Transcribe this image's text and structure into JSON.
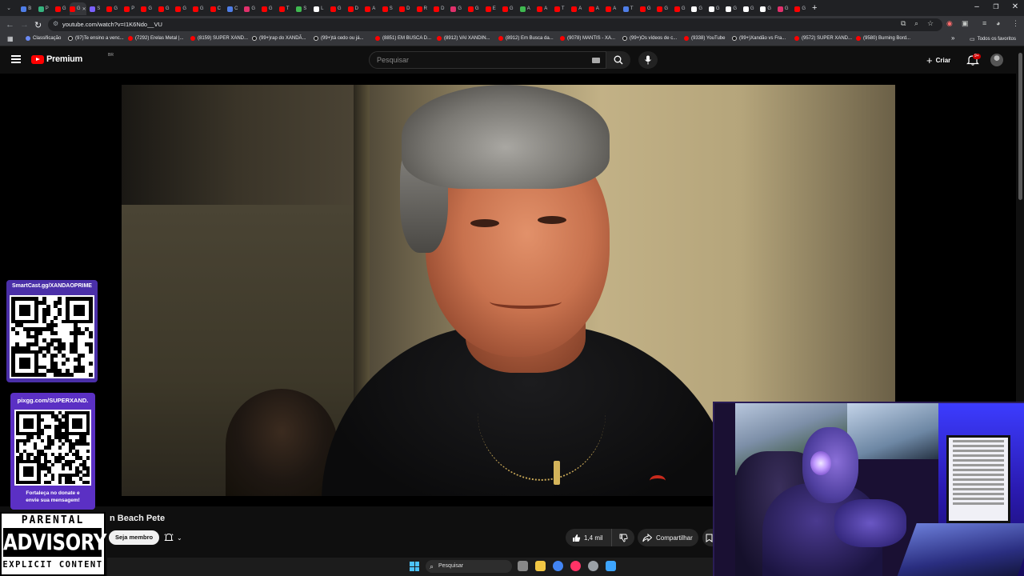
{
  "browser": {
    "tabs": [
      {
        "letter": "B",
        "color": "#4f7ee8"
      },
      {
        "letter": "P",
        "color": "#36b37e"
      },
      {
        "letter": "G",
        "color": "#ff0000"
      },
      {
        "letter": "G",
        "color": "#ff0000",
        "active": true
      },
      {
        "letter": "S",
        "color": "#7b61ff"
      },
      {
        "letter": "G",
        "color": "#ff0000"
      },
      {
        "letter": "P",
        "color": "#ff0000"
      },
      {
        "letter": "G",
        "color": "#ff0000"
      },
      {
        "letter": "G",
        "color": "#ff0000"
      },
      {
        "letter": "G",
        "color": "#ff0000"
      },
      {
        "letter": "G",
        "color": "#ff0000"
      },
      {
        "letter": "C",
        "color": "#ff0000"
      },
      {
        "letter": "C",
        "color": "#4f7ee8"
      },
      {
        "letter": "G",
        "color": "#e1306c"
      },
      {
        "letter": "G",
        "color": "#ff0000"
      },
      {
        "letter": "T",
        "color": "#ff0000"
      },
      {
        "letter": "S",
        "color": "#3fb950"
      },
      {
        "letter": "L",
        "color": "#ffffff"
      },
      {
        "letter": "G",
        "color": "#ff0000"
      },
      {
        "letter": "D",
        "color": "#ff0000"
      },
      {
        "letter": "A",
        "color": "#ff0000"
      },
      {
        "letter": "S",
        "color": "#ff0000"
      },
      {
        "letter": "D",
        "color": "#ff0000"
      },
      {
        "letter": "R",
        "color": "#ff0000"
      },
      {
        "letter": "D",
        "color": "#ff0000"
      },
      {
        "letter": "G",
        "color": "#e1306c"
      },
      {
        "letter": "G",
        "color": "#ff0000"
      },
      {
        "letter": "E",
        "color": "#ff0000"
      },
      {
        "letter": "G",
        "color": "#ff0000"
      },
      {
        "letter": "A",
        "color": "#3fb950"
      },
      {
        "letter": "A",
        "color": "#ff0000"
      },
      {
        "letter": "T",
        "color": "#ff0000"
      },
      {
        "letter": "A",
        "color": "#ff0000"
      },
      {
        "letter": "A",
        "color": "#ff0000"
      },
      {
        "letter": "A",
        "color": "#ff0000"
      },
      {
        "letter": "T",
        "color": "#4f7ee8"
      },
      {
        "letter": "G",
        "color": "#ff0000"
      },
      {
        "letter": "G",
        "color": "#ff0000"
      },
      {
        "letter": "G",
        "color": "#ff0000"
      },
      {
        "letter": "G",
        "color": "#ffffff"
      },
      {
        "letter": "G",
        "color": "#ffffff"
      },
      {
        "letter": "G",
        "color": "#ffffff"
      },
      {
        "letter": "G",
        "color": "#ffffff"
      },
      {
        "letter": "G",
        "color": "#ffffff"
      },
      {
        "letter": "G",
        "color": "#e1306c"
      },
      {
        "letter": "G",
        "color": "#ff0000"
      }
    ],
    "url": "youtube.com/watch?v=I1K6Ndo__VU",
    "bookmarks": [
      {
        "label": "Classificação",
        "kind": "cl"
      },
      {
        "label": "(97)Te ensino a venc...",
        "kind": "tk"
      },
      {
        "label": "(7292) Erelas Metal |...",
        "kind": "yt"
      },
      {
        "label": "(8159) SUPER XAND...",
        "kind": "yt"
      },
      {
        "label": "(99+)rap do XANDÃ...",
        "kind": "tk"
      },
      {
        "label": "(99+)tá cedo ou já...",
        "kind": "tk"
      },
      {
        "label": "(8851) EM BUSCA D...",
        "kind": "yt"
      },
      {
        "label": "(8912) VAI XANDIN...",
        "kind": "yt"
      },
      {
        "label": "(8912) Em Busca da...",
        "kind": "yt"
      },
      {
        "label": "(9078) MANTIS - XA...",
        "kind": "yt"
      },
      {
        "label": "(99+)Os vídeos de c...",
        "kind": "tk"
      },
      {
        "label": "(9338) YouTube",
        "kind": "yt"
      },
      {
        "label": "(99+)Xandão vs Fra...",
        "kind": "tk"
      },
      {
        "label": "(9572) SUPER XAND...",
        "kind": "yt"
      },
      {
        "label": "(9580) Burning Bord...",
        "kind": "yt"
      }
    ],
    "all_bookmarks_label": "Todos os favoritos"
  },
  "youtube": {
    "logo_text": "Premium",
    "country_code": "BR",
    "search_placeholder": "Pesquisar",
    "create_label": "Criar",
    "notification_badge": "9+",
    "video_title": "n Beach Pete",
    "join_label": "Seja membro",
    "like_count": "1,4 mil",
    "share_label": "Compartilhar"
  },
  "overlays": {
    "qr1_title": "SmartCast.gg/XANDAOPRIME",
    "qr2_title": "pixgg.com/SUPERXAND.",
    "qr2_message_line1": "Fortaleça no donate e",
    "qr2_message_line2": "envie sua mensagem!",
    "advisory_top": "PARENTAL",
    "advisory_middle": "ADVISORY",
    "advisory_bottom": "EXPLICIT CONTENT"
  },
  "taskbar": {
    "search_placeholder": "Pesquisar",
    "apps": [
      {
        "name": "task-view",
        "color": "#888888"
      },
      {
        "name": "file-explorer",
        "color": "#f2c744"
      },
      {
        "name": "chrome",
        "color": "#4285f4"
      },
      {
        "name": "opera-gx",
        "color": "#ff3366"
      },
      {
        "name": "settings",
        "color": "#9aa0a6"
      },
      {
        "name": "app",
        "color": "#3da5ff"
      }
    ]
  }
}
